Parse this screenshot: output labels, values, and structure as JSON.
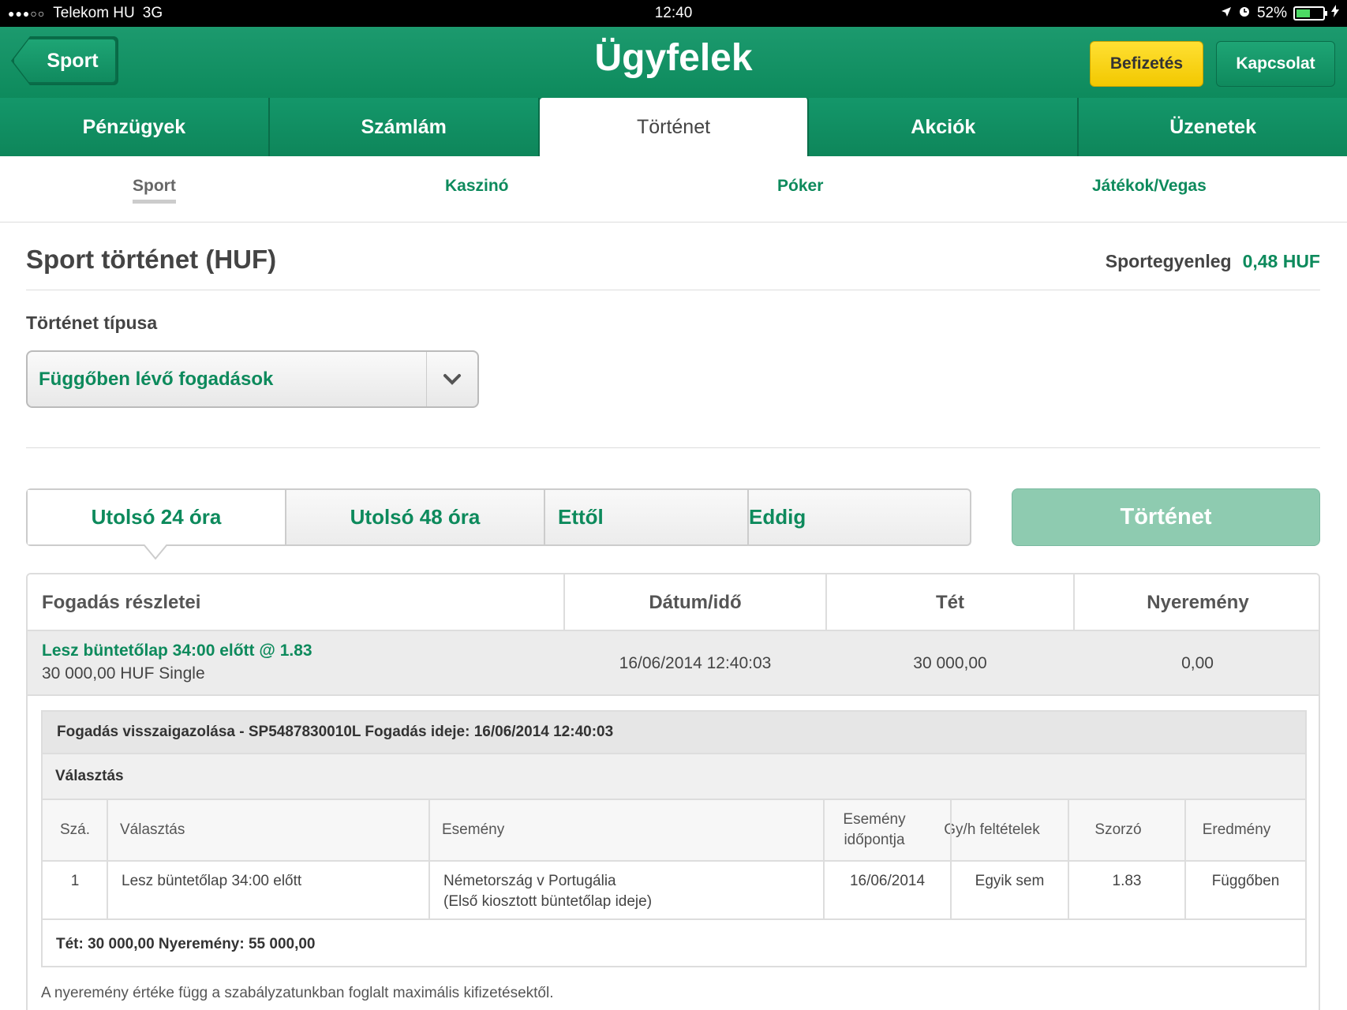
{
  "status_bar": {
    "signal": "●●●○○",
    "carrier": "Telekom HU",
    "network": "3G",
    "time": "12:40",
    "battery": "52%",
    "battery_level": 0.52
  },
  "header": {
    "back_label": "Sport",
    "title": "Ügyfelek",
    "deposit_label": "Befizetés",
    "contact_label": "Kapcsolat"
  },
  "tabs": [
    {
      "label": "Pénzügyek",
      "active": false
    },
    {
      "label": "Számlám",
      "active": false
    },
    {
      "label": "Történet",
      "active": true
    },
    {
      "label": "Akciók",
      "active": false
    },
    {
      "label": "Üzenetek",
      "active": false
    }
  ],
  "subtabs": [
    {
      "label": "Sport",
      "active": true
    },
    {
      "label": "Kaszinó",
      "active": false
    },
    {
      "label": "Póker",
      "active": false
    },
    {
      "label": "Játékok/Vegas",
      "active": false
    }
  ],
  "content": {
    "title": "Sport történet (HUF)",
    "balance_label": "Sportegyenleg",
    "balance_value": "0,48 HUF",
    "type_label": "Történet típusa",
    "type_value": "Függőben lévő fogadások"
  },
  "range": {
    "last24": "Utolsó 24 óra",
    "last48": "Utolsó 48 óra",
    "from": "Ettől",
    "to": "Eddig",
    "history_button": "Történet"
  },
  "table": {
    "headers": [
      "Fogadás részletei",
      "Dátum/idő",
      "Tét",
      "Nyeremény"
    ],
    "row": {
      "title": "Lesz büntetőlap 34:00 előtt @ 1.83",
      "subtitle": "30 000,00 HUF  Single",
      "datetime": "16/06/2014 12:40:03",
      "stake": "30 000,00",
      "winnings": "0,00"
    },
    "detail": {
      "confirmation": "Fogadás visszaigazolása  - SP5487830010L   Fogadás ideje:  16/06/2014 12:40:03",
      "selection_label": "Választás",
      "columns": [
        "Szá.",
        "Választás",
        "Esemény",
        "Esemény időpontja",
        "Gy/h feltételek",
        "Szorzó",
        "Eredmény"
      ],
      "row": {
        "no": "1",
        "selection": "Lesz büntetőlap 34:00 előtt",
        "event_line1": "Németország v Portugália",
        "event_line2": "(Első kiosztott büntetőlap ideje)",
        "event_date": "16/06/2014",
        "conditions": "Egyik sem",
        "odds": "1.83",
        "result": "Függőben"
      },
      "footer": "Tét:  30 000,00    Nyeremény:  55 000,00"
    },
    "note": "A nyeremény értéke függ a szabályzatunkban foglalt maximális kifizetésektől."
  },
  "colors": {
    "brand_green": "#0d8a5c",
    "deposit_yellow": "#f2c800",
    "history_button": "#8ecbb0"
  }
}
